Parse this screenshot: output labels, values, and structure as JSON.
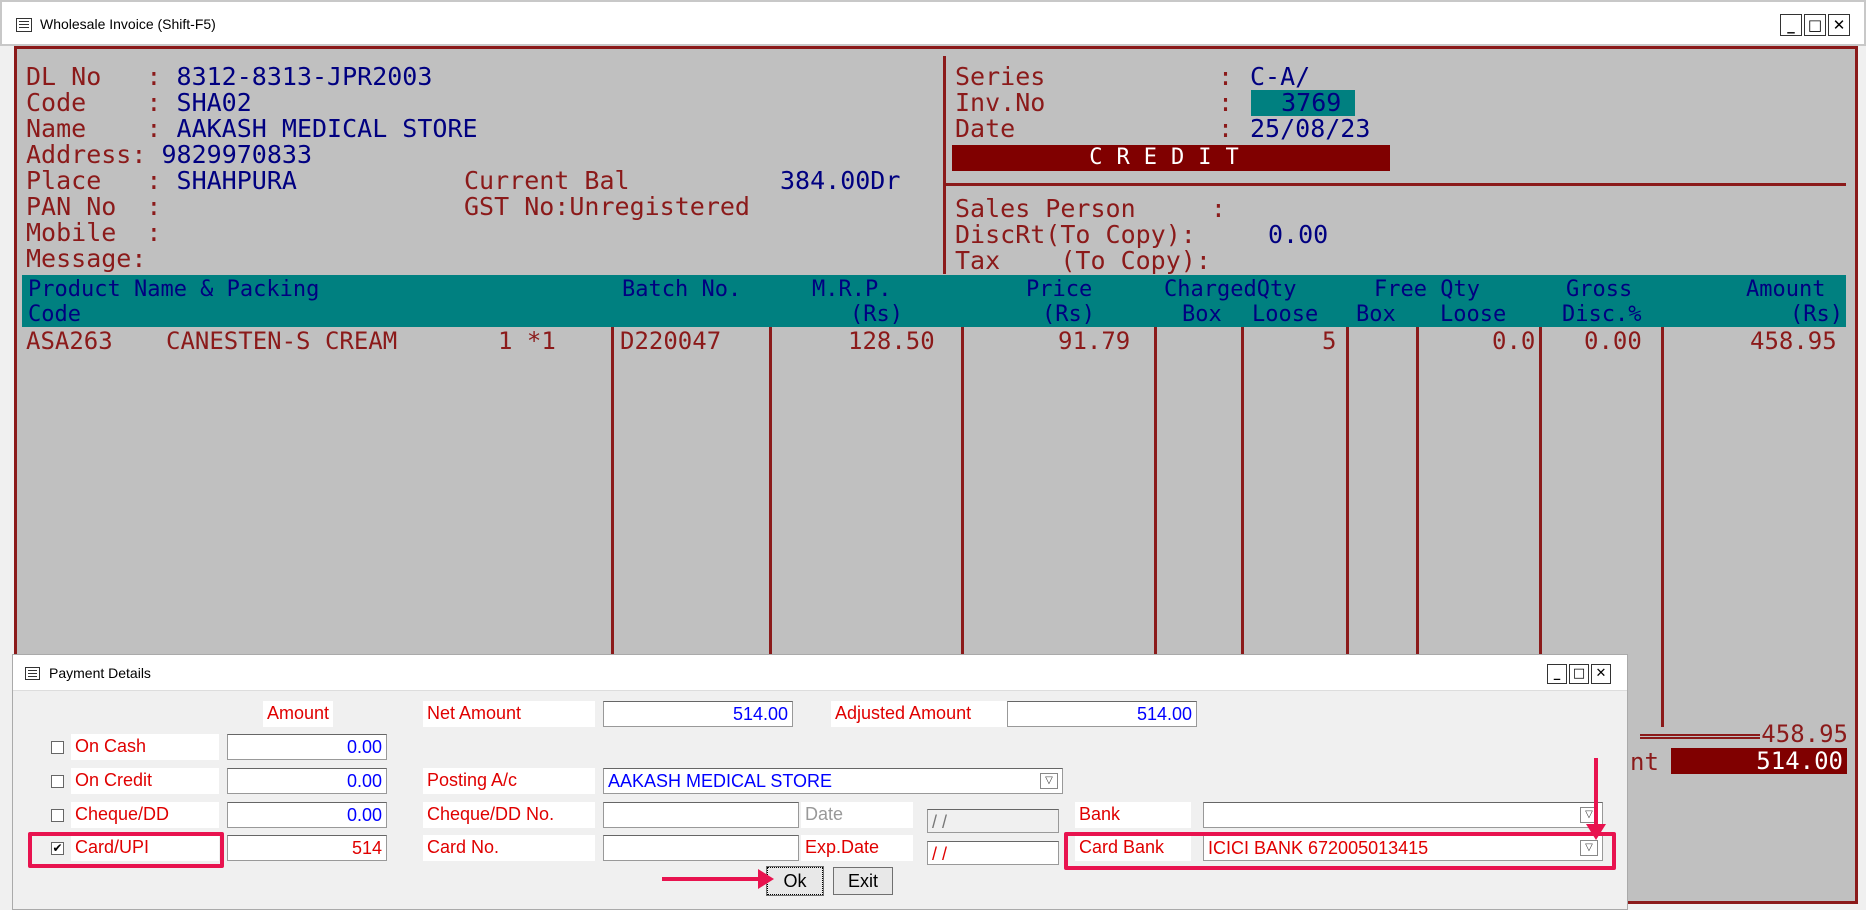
{
  "window": {
    "title": "Wholesale Invoice (Shift-F5)"
  },
  "party": {
    "dl_no_label": "DL No   :",
    "dl_no": "8312-8313-JPR2003",
    "code_label": "Code    :",
    "code": "SHA02",
    "name_label": "Name    :",
    "name": "AAKASH MEDICAL STORE",
    "address_label": "Address:",
    "address": "9829970833",
    "place_label": "Place   :",
    "place": "SHAHPURA",
    "current_bal_label": "Current Bal",
    "current_bal": "384.00Dr",
    "pan_label": "PAN No  :",
    "gst_label": "GST No:Unregistered",
    "mobile_label": "Mobile  :",
    "message_label": "Message:"
  },
  "invoice": {
    "series_label": "Series",
    "series_colon": ":",
    "series": "C-A/",
    "inv_no_label": "Inv.No",
    "inv_no_colon": ":",
    "inv_no": "  3769",
    "date_label": "Date",
    "date_colon": ":",
    "date": "25/08/23",
    "mode": "CREDIT",
    "sales_person_label": "Sales Person     :",
    "disc_label": "DiscRt(To Copy):",
    "disc_value": "0.00",
    "tax_label": "Tax    (To Copy):"
  },
  "grid": {
    "headers": {
      "product_name": "Product Name & Packing",
      "code": "Code",
      "batch": "Batch No.",
      "mrp": "M.R.P.",
      "mrp_unit": "(Rs)",
      "price": "Price",
      "price_unit": "(Rs)",
      "charged_qty": "ChargedQty",
      "box": "Box",
      "loose": "Loose",
      "free_qty": "Free Qty",
      "free_box": "Box",
      "free_loose": "Loose",
      "gross": "Gross",
      "disc": "Disc.%",
      "amount": "Amount",
      "amount_unit": "(Rs)"
    },
    "rows": [
      {
        "code": "ASA263",
        "product": "CANESTEN-S CREAM",
        "pack": "1 *1",
        "batch": "D220047",
        "mrp": "128.50",
        "price": "91.79",
        "loose": "5",
        "free_loose": "0.0",
        "disc": "0.00",
        "amount": "458.95"
      }
    ]
  },
  "totals": {
    "gross": "458.95",
    "net_label_fragment": "nt",
    "net": "514.00"
  },
  "payment": {
    "title": "Payment Details",
    "amount_header": "Amount",
    "net_amount_label": "Net Amount",
    "net_amount": "514.00",
    "adjusted_amount_label": "Adjusted Amount",
    "adjusted_amount": "514.00",
    "on_cash_label": "On Cash",
    "on_cash": "0.00",
    "on_credit_label": "On Credit",
    "on_credit": "0.00",
    "cheque_label": "Cheque/DD",
    "cheque": "0.00",
    "card_label": "Card/UPI",
    "card": "514",
    "posting_label": "Posting A/c",
    "posting": "AAKASH MEDICAL STORE",
    "cheque_no_label": "Cheque/DD No.",
    "date_placeholder": "Date",
    "date_value": " /  /",
    "bank_label": "Bank",
    "bank": "",
    "card_no_label": "Card No.",
    "exp_date_label": "Exp.Date",
    "exp_date_value": " /  /",
    "card_bank_label": "Card Bank",
    "card_bank": "ICICI BANK 672005013415",
    "ok_label": "Ok",
    "exit_label": "Exit",
    "card_checked": "✔"
  }
}
